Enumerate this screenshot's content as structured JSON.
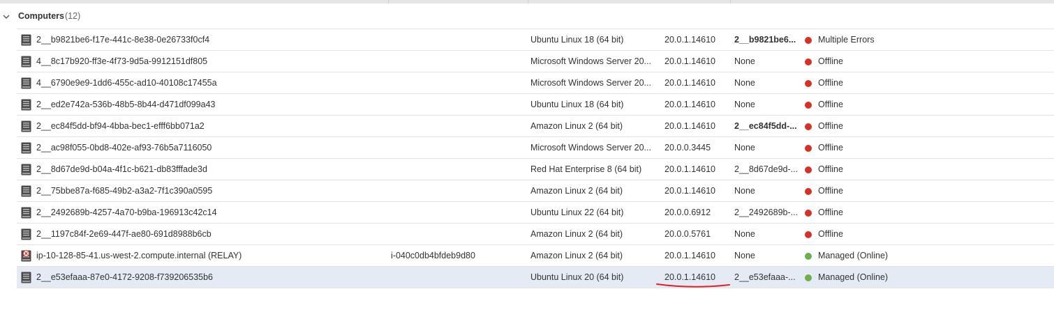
{
  "group": {
    "title": "Computers",
    "count": "(12)"
  },
  "colors": {
    "error": "#d93025",
    "online": "#6ab04c",
    "selected_row": "#e4ebf5",
    "annotation": "#e02020"
  },
  "rows": [
    {
      "name": "2__b9821be6-f17e-441c-8e38-0e26733f0cf4",
      "instance": "",
      "os": "Ubuntu Linux 18 (64 bit)",
      "version": "20.0.1.14610",
      "host": "2__b9821be6...",
      "host_bold": true,
      "status": "Multiple Errors",
      "state": "error",
      "icon": "server-icon"
    },
    {
      "name": "4__8c17b920-ff3e-4f73-9d5a-9912151df805",
      "instance": "",
      "os": "Microsoft Windows Server 20...",
      "version": "20.0.1.14610",
      "host": "None",
      "host_bold": false,
      "status": "Offline",
      "state": "error",
      "icon": "server-icon"
    },
    {
      "name": "4__6790e9e9-1dd6-455c-ad10-40108c17455a",
      "instance": "",
      "os": "Microsoft Windows Server 20...",
      "version": "20.0.1.14610",
      "host": "None",
      "host_bold": false,
      "status": "Offline",
      "state": "error",
      "icon": "server-icon"
    },
    {
      "name": "2__ed2e742a-536b-48b5-8b44-d471df099a43",
      "instance": "",
      "os": "Ubuntu Linux 18 (64 bit)",
      "version": "20.0.1.14610",
      "host": "None",
      "host_bold": false,
      "status": "Offline",
      "state": "error",
      "icon": "server-icon"
    },
    {
      "name": "2__ec84f5dd-bf94-4bba-bec1-efff6bb071a2",
      "instance": "",
      "os": "Amazon Linux 2 (64 bit)",
      "version": "20.0.1.14610",
      "host": "2__ec84f5dd-...",
      "host_bold": true,
      "status": "Offline",
      "state": "error",
      "icon": "server-icon"
    },
    {
      "name": "2__ac98f055-0bd8-402e-af93-76b5a7116050",
      "instance": "",
      "os": "Microsoft Windows Server 20...",
      "version": "20.0.0.3445",
      "host": "None",
      "host_bold": false,
      "status": "Offline",
      "state": "error",
      "icon": "server-icon"
    },
    {
      "name": "2__8d67de9d-b04a-4f1c-b621-db83fffade3d",
      "instance": "",
      "os": "Red Hat Enterprise 8 (64 bit)",
      "version": "20.0.1.14610",
      "host": "2__8d67de9d-...",
      "host_bold": false,
      "status": "Offline",
      "state": "error",
      "icon": "server-icon"
    },
    {
      "name": "2__75bbe87a-f685-49b2-a3a2-7f1c390a0595",
      "instance": "",
      "os": "Amazon Linux 2 (64 bit)",
      "version": "20.0.1.14610",
      "host": "None",
      "host_bold": false,
      "status": "Offline",
      "state": "error",
      "icon": "server-icon"
    },
    {
      "name": "2__2492689b-4257-4a70-b9ba-196913c42c14",
      "instance": "",
      "os": "Ubuntu Linux 22 (64 bit)",
      "version": "20.0.0.6912",
      "host": "2__2492689b-...",
      "host_bold": false,
      "status": "Offline",
      "state": "error",
      "icon": "server-icon"
    },
    {
      "name": "2__1197c84f-2e69-447f-ae80-691d8988b6cb",
      "instance": "",
      "os": "Amazon Linux 2 (64 bit)",
      "version": "20.0.0.5761",
      "host": "None",
      "host_bold": false,
      "status": "Offline",
      "state": "error",
      "icon": "server-icon"
    },
    {
      "name": "ip-10-128-85-41.us-west-2.compute.internal (RELAY)",
      "instance": "i-040c0db4bfdeb9d80",
      "os": "Amazon Linux 2 (64 bit)",
      "version": "20.0.1.14610",
      "host": "None",
      "host_bold": false,
      "status": "Managed (Online)",
      "state": "online",
      "icon": "relay-server-icon"
    },
    {
      "name": "2__e53efaaa-87e0-4172-9208-f739206535b6",
      "instance": "",
      "os": "Ubuntu Linux 20 (64 bit)",
      "version": "20.0.1.14610",
      "host": "2__e53efaaa-...",
      "host_bold": false,
      "status": "Managed (Online)",
      "state": "online",
      "icon": "server-icon",
      "selected": true
    }
  ]
}
